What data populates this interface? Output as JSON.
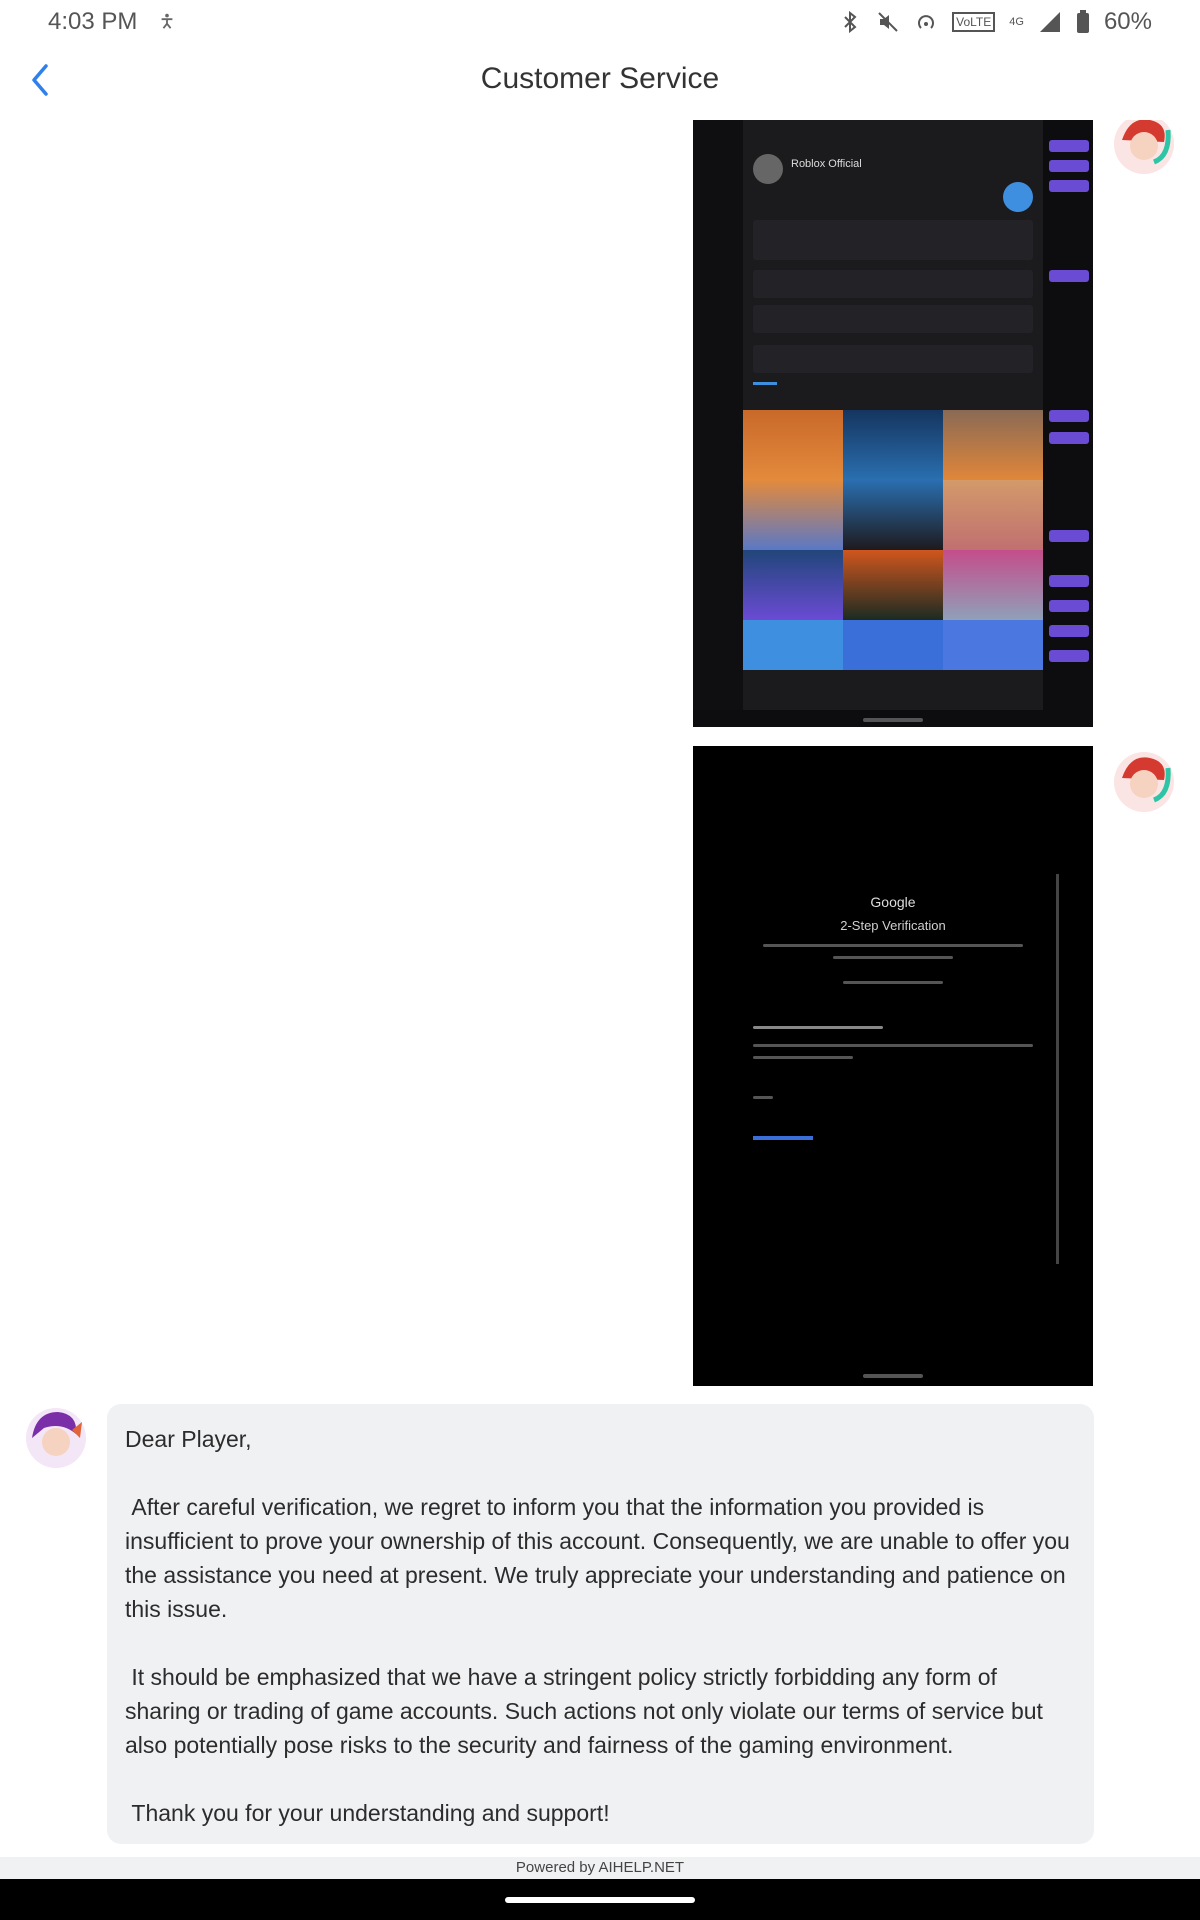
{
  "status_bar": {
    "time": "4:03 PM",
    "battery_percent": "60%",
    "network_label": "4G",
    "volte_label": "VoLTE"
  },
  "header": {
    "title": "Customer Service"
  },
  "messages": [
    {
      "type": "image",
      "sender": "user",
      "description_icon": "screenshot-thumbnail",
      "inner_texts": [
        "Roblox Official"
      ]
    },
    {
      "type": "image",
      "sender": "user",
      "inner_texts": [
        "Google",
        "2-Step Verification"
      ]
    },
    {
      "type": "text",
      "sender": "agent",
      "paragraphs": [
        "Dear Player,",
        " After careful verification, we regret to inform you that the information you provided is insufficient to prove your ownership of this account. Consequently, we are unable to offer you the assistance you need at present. We truly appreciate your understanding and patience on this issue.",
        " It should be emphasized that we have a stringent policy strictly forbidding any form of sharing or trading of game accounts. Such actions not only violate our terms of service but also potentially pose risks to the security and fairness of the gaming environment.",
        " Thank you for your understanding and support!"
      ]
    }
  ],
  "footer": {
    "powered_by": "Powered by AIHELP.NET"
  },
  "colors": {
    "accent": "#2f80ed",
    "bubble_bg": "#f0f1f3",
    "tile_purple": "#6a4bd4"
  }
}
